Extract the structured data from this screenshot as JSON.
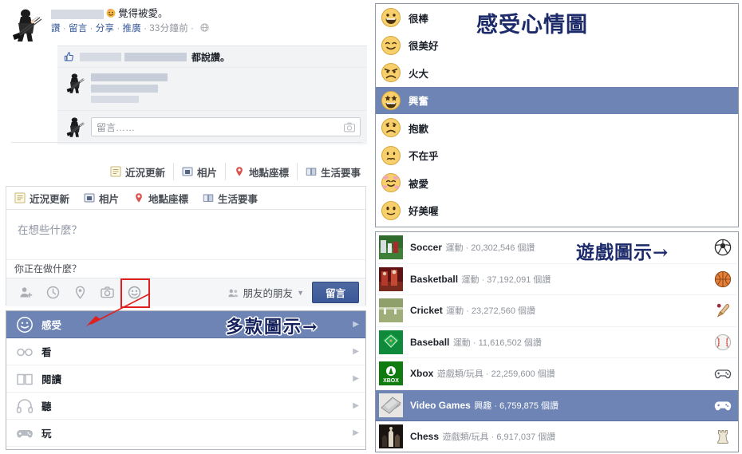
{
  "post": {
    "author_redacted": true,
    "emoji": "smiling-face-with-hearts",
    "feeling_text": "覺得被愛。",
    "actions": [
      "讚",
      "留言",
      "分享",
      "推廣"
    ],
    "timestamp": "33分鐘前",
    "privacy_icon": "globe-icon",
    "likes_suffix": "都說讚。",
    "comment_placeholder": "留言……",
    "camera_icon": "camera-icon"
  },
  "tabs_upper": [
    {
      "label": "近況更新",
      "icon": "status-update-icon"
    },
    {
      "label": "相片",
      "icon": "photo-icon"
    },
    {
      "label": "地點座標",
      "icon": "location-pin-icon"
    },
    {
      "label": "生活要事",
      "icon": "life-event-icon"
    }
  ],
  "composer": {
    "tabs": [
      {
        "label": "近況更新",
        "icon": "status-update-icon"
      },
      {
        "label": "相片",
        "icon": "photo-icon"
      },
      {
        "label": "地點座標",
        "icon": "location-pin-icon"
      },
      {
        "label": "生活要事",
        "icon": "life-event-icon"
      }
    ],
    "placeholder": "在想些什麼？",
    "activity_prompt": "你正在做什麼？",
    "toolbar_icons": [
      "tag-friends-icon",
      "clock-icon",
      "location-pin-icon",
      "camera-icon",
      "feeling-smiley-icon"
    ],
    "audience_label": "朋友的朋友",
    "audience_icon": "friends-of-friends-icon",
    "audience_caret": "▼",
    "post_button": "留言",
    "highlight_target": "feeling-smiley-icon"
  },
  "menu": {
    "items": [
      {
        "label": "感受",
        "icon": "smiley-outline-icon",
        "selected": true,
        "arrow": "▶"
      },
      {
        "label": "看",
        "icon": "glasses-icon",
        "selected": false,
        "arrow": "▶"
      },
      {
        "label": "閱讀",
        "icon": "open-book-icon",
        "selected": false,
        "arrow": "▶"
      },
      {
        "label": "聽",
        "icon": "headphones-icon",
        "selected": false,
        "arrow": "▶"
      },
      {
        "label": "玩",
        "icon": "gamepad-icon",
        "selected": false,
        "arrow": "▶"
      }
    ]
  },
  "annotations": {
    "feelings_title": "感受心情圖",
    "game_icons_title": "遊戲圖示→",
    "many_icons_title": "多款圖示→",
    "arrow_color": "#e02020",
    "highlight_color": "#6d84b4",
    "annotation_color": "#1d2b6b"
  },
  "feelings": {
    "items": [
      {
        "label": "很棒",
        "emoji": "grinning-face",
        "selected": false
      },
      {
        "label": "很美好",
        "emoji": "smiling-closed-eyes",
        "selected": false
      },
      {
        "label": "火大",
        "emoji": "angry-frowning-face",
        "selected": false
      },
      {
        "label": "興奮",
        "emoji": "star-struck-face",
        "selected": true
      },
      {
        "label": "抱歉",
        "emoji": "sad-face",
        "selected": false
      },
      {
        "label": "不在乎",
        "emoji": "indifferent-face",
        "selected": false
      },
      {
        "label": "被愛",
        "emoji": "face-with-hearts",
        "selected": false
      },
      {
        "label": "好美喔",
        "emoji": "wide-eyed-face",
        "selected": false
      }
    ]
  },
  "games": {
    "unit": "個讚",
    "items": [
      {
        "name": "Soccer",
        "category": "運動",
        "likes": "20,302,546",
        "meta": "運動 · 20,302,546 個讚",
        "icon": "soccer-ball-icon",
        "thumb": "soccer-photo",
        "selected": false
      },
      {
        "name": "Basketball",
        "category": "運動",
        "likes": "37,192,091",
        "meta": "運動 · 37,192,091 個讚",
        "icon": "basketball-icon",
        "thumb": "basketball-photo",
        "selected": false
      },
      {
        "name": "Cricket",
        "category": "運動",
        "likes": "23,272,560",
        "meta": "運動 · 23,272,560 個讚",
        "icon": "cricket-bat-icon",
        "thumb": "cricket-photo",
        "selected": false
      },
      {
        "name": "Baseball",
        "category": "運動",
        "likes": "11,616,502",
        "meta": "運動 · 11,616,502 個讚",
        "icon": "baseball-icon",
        "thumb": "baseball-field",
        "selected": false
      },
      {
        "name": "Xbox",
        "category": "遊戲類/玩具",
        "likes": "22,259,600",
        "meta": "遊戲類/玩具 · 22,259,600 個讚",
        "icon": "gamepad-icon",
        "thumb": "xbox-logo",
        "selected": false
      },
      {
        "name": "Video Games",
        "category": "興趣",
        "likes": "6,759,875",
        "meta": "興趣 · 6,759,875 個讚",
        "icon": "gamepad-icon",
        "thumb": "video-game-photo",
        "selected": true
      },
      {
        "name": "Chess",
        "category": "遊戲類/玩具",
        "likes": "6,917,037",
        "meta": "遊戲類/玩具 · 6,917,037 個讚",
        "icon": "chess-rook-icon",
        "thumb": "chess-photo",
        "selected": false
      }
    ]
  }
}
